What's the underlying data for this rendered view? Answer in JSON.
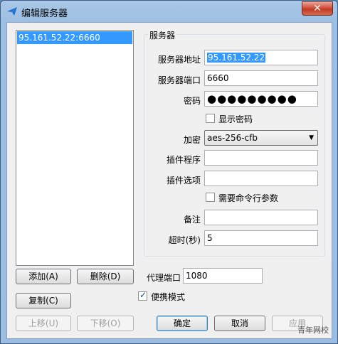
{
  "window": {
    "title": "编辑服务器",
    "close_symbol": "✕"
  },
  "server_list": {
    "items": [
      "95.161.52.22:6660"
    ]
  },
  "list_buttons": {
    "add": "添加(A)",
    "delete": "删除(D)",
    "copy": "复制(C)",
    "move_up": "上移(U)",
    "move_down": "下移(O)"
  },
  "server_group": {
    "title": "服务器",
    "address_label": "服务器地址",
    "address_value": "95.161.52.22",
    "port_label": "服务器端口",
    "port_value": "6660",
    "password_label": "密码",
    "password_value": "●●●●●●●●●",
    "show_password_label": "显示密码",
    "show_password_checked": false,
    "encryption_label": "加密",
    "encryption_value": "aes-256-cfb",
    "plugin_program_label": "插件程序",
    "plugin_program_value": "",
    "plugin_options_label": "插件选项",
    "plugin_options_value": "",
    "needs_cmd_args_label": "需要命令行参数",
    "needs_cmd_args_checked": false,
    "remarks_label": "备注",
    "remarks_value": "",
    "timeout_label": "超时(秒)",
    "timeout_value": "5"
  },
  "proxy": {
    "port_label": "代理端口",
    "port_value": "1080"
  },
  "portable_mode": {
    "label": "便携模式",
    "checked": true
  },
  "dialog_buttons": {
    "ok": "确定",
    "cancel": "取消",
    "apply": "应用"
  },
  "watermark": "青年网校"
}
